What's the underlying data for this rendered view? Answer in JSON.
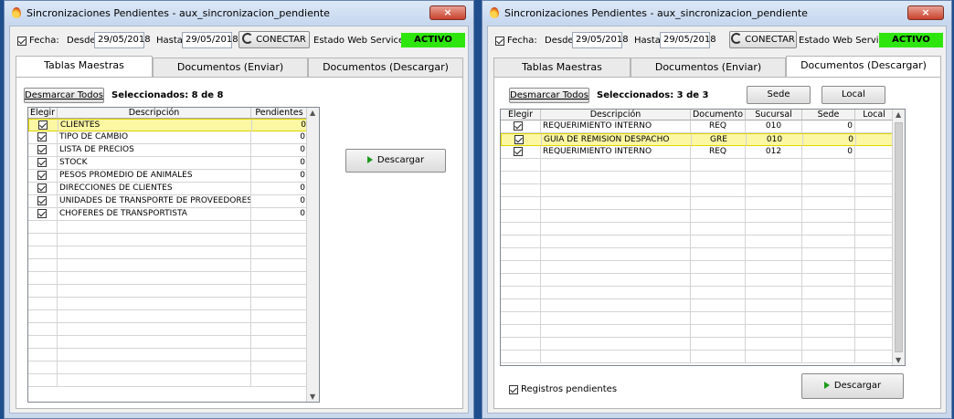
{
  "title": "Sincronizaciones Pendientes - aux_sincronizacion_pendiente",
  "close_label": "×",
  "filter": {
    "fecha_label": "Fecha:",
    "desde_label": "Desde",
    "desde_value": "29/05/2018",
    "hasta_label": "Hasta",
    "hasta_value": "29/05/2018",
    "conectar_label": "CONECTAR",
    "estado_label": "Estado Web Service",
    "estado_value": "ACTIVO",
    "estado_color": "#2ee60e"
  },
  "tabs": [
    "Tablas Maestras",
    "Documentos (Enviar)",
    "Documentos (Descargar)"
  ],
  "left": {
    "active_tab": 0,
    "toggle_label": "Desmarcar Todos",
    "selected_text": "Seleccionados: 8 de 8",
    "columns": [
      "Elegir",
      "Descripción",
      "Pendientes"
    ],
    "rows": [
      {
        "desc": "CLIENTES",
        "pend": "0",
        "selected": true
      },
      {
        "desc": "TIPO DE CAMBIO",
        "pend": "0"
      },
      {
        "desc": "LISTA DE PRECIOS",
        "pend": "0"
      },
      {
        "desc": "STOCK",
        "pend": "0"
      },
      {
        "desc": "PESOS PROMEDIO DE ANIMALES",
        "pend": "0"
      },
      {
        "desc": "DIRECCIONES DE CLIENTES",
        "pend": "0"
      },
      {
        "desc": "UNIDADES DE TRANSPORTE DE PROVEEDORES",
        "pend": "0"
      },
      {
        "desc": "CHOFERES DE TRANSPORTISTA",
        "pend": "0"
      }
    ],
    "download_label": "Descargar"
  },
  "right": {
    "active_tab": 2,
    "toggle_label": "Desmarcar Todos",
    "selected_text": "Seleccionados: 3 de 3",
    "sede_label": "Sede",
    "local_label": "Local",
    "columns": [
      "Elegir",
      "Descripción",
      "Documento",
      "Sucursal",
      "Sede",
      "Local"
    ],
    "rows": [
      {
        "desc": "REQUERIMIENTO INTERNO",
        "doc": "REQ",
        "suc": "010",
        "sede": "0",
        "local": ""
      },
      {
        "desc": "GUIA DE REMISION DESPACHO",
        "doc": "GRE",
        "suc": "010",
        "sede": "0",
        "local": "",
        "selected": true
      },
      {
        "desc": "REQUERIMIENTO INTERNO",
        "doc": "REQ",
        "suc": "012",
        "sede": "0",
        "local": ""
      }
    ],
    "pending_label": "Registros pendientes",
    "download_label": "Descargar"
  }
}
